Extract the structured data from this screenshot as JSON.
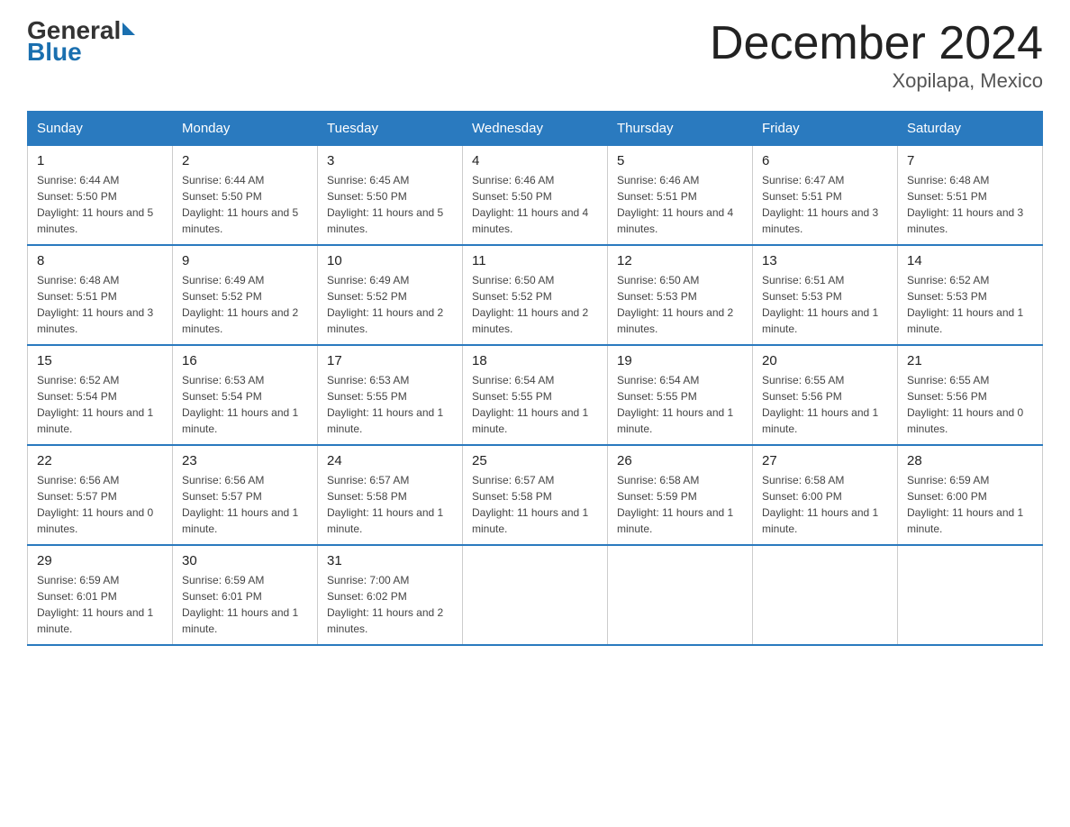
{
  "logo": {
    "line1": "General",
    "line2": "Blue",
    "triangle": true
  },
  "title": "December 2024",
  "subtitle": "Xopilapa, Mexico",
  "days_of_week": [
    "Sunday",
    "Monday",
    "Tuesday",
    "Wednesday",
    "Thursday",
    "Friday",
    "Saturday"
  ],
  "weeks": [
    [
      {
        "day": "1",
        "sunrise": "6:44 AM",
        "sunset": "5:50 PM",
        "daylight": "11 hours and 5 minutes."
      },
      {
        "day": "2",
        "sunrise": "6:44 AM",
        "sunset": "5:50 PM",
        "daylight": "11 hours and 5 minutes."
      },
      {
        "day": "3",
        "sunrise": "6:45 AM",
        "sunset": "5:50 PM",
        "daylight": "11 hours and 5 minutes."
      },
      {
        "day": "4",
        "sunrise": "6:46 AM",
        "sunset": "5:50 PM",
        "daylight": "11 hours and 4 minutes."
      },
      {
        "day": "5",
        "sunrise": "6:46 AM",
        "sunset": "5:51 PM",
        "daylight": "11 hours and 4 minutes."
      },
      {
        "day": "6",
        "sunrise": "6:47 AM",
        "sunset": "5:51 PM",
        "daylight": "11 hours and 3 minutes."
      },
      {
        "day": "7",
        "sunrise": "6:48 AM",
        "sunset": "5:51 PM",
        "daylight": "11 hours and 3 minutes."
      }
    ],
    [
      {
        "day": "8",
        "sunrise": "6:48 AM",
        "sunset": "5:51 PM",
        "daylight": "11 hours and 3 minutes."
      },
      {
        "day": "9",
        "sunrise": "6:49 AM",
        "sunset": "5:52 PM",
        "daylight": "11 hours and 2 minutes."
      },
      {
        "day": "10",
        "sunrise": "6:49 AM",
        "sunset": "5:52 PM",
        "daylight": "11 hours and 2 minutes."
      },
      {
        "day": "11",
        "sunrise": "6:50 AM",
        "sunset": "5:52 PM",
        "daylight": "11 hours and 2 minutes."
      },
      {
        "day": "12",
        "sunrise": "6:50 AM",
        "sunset": "5:53 PM",
        "daylight": "11 hours and 2 minutes."
      },
      {
        "day": "13",
        "sunrise": "6:51 AM",
        "sunset": "5:53 PM",
        "daylight": "11 hours and 1 minute."
      },
      {
        "day": "14",
        "sunrise": "6:52 AM",
        "sunset": "5:53 PM",
        "daylight": "11 hours and 1 minute."
      }
    ],
    [
      {
        "day": "15",
        "sunrise": "6:52 AM",
        "sunset": "5:54 PM",
        "daylight": "11 hours and 1 minute."
      },
      {
        "day": "16",
        "sunrise": "6:53 AM",
        "sunset": "5:54 PM",
        "daylight": "11 hours and 1 minute."
      },
      {
        "day": "17",
        "sunrise": "6:53 AM",
        "sunset": "5:55 PM",
        "daylight": "11 hours and 1 minute."
      },
      {
        "day": "18",
        "sunrise": "6:54 AM",
        "sunset": "5:55 PM",
        "daylight": "11 hours and 1 minute."
      },
      {
        "day": "19",
        "sunrise": "6:54 AM",
        "sunset": "5:55 PM",
        "daylight": "11 hours and 1 minute."
      },
      {
        "day": "20",
        "sunrise": "6:55 AM",
        "sunset": "5:56 PM",
        "daylight": "11 hours and 1 minute."
      },
      {
        "day": "21",
        "sunrise": "6:55 AM",
        "sunset": "5:56 PM",
        "daylight": "11 hours and 0 minutes."
      }
    ],
    [
      {
        "day": "22",
        "sunrise": "6:56 AM",
        "sunset": "5:57 PM",
        "daylight": "11 hours and 0 minutes."
      },
      {
        "day": "23",
        "sunrise": "6:56 AM",
        "sunset": "5:57 PM",
        "daylight": "11 hours and 1 minute."
      },
      {
        "day": "24",
        "sunrise": "6:57 AM",
        "sunset": "5:58 PM",
        "daylight": "11 hours and 1 minute."
      },
      {
        "day": "25",
        "sunrise": "6:57 AM",
        "sunset": "5:58 PM",
        "daylight": "11 hours and 1 minute."
      },
      {
        "day": "26",
        "sunrise": "6:58 AM",
        "sunset": "5:59 PM",
        "daylight": "11 hours and 1 minute."
      },
      {
        "day": "27",
        "sunrise": "6:58 AM",
        "sunset": "6:00 PM",
        "daylight": "11 hours and 1 minute."
      },
      {
        "day": "28",
        "sunrise": "6:59 AM",
        "sunset": "6:00 PM",
        "daylight": "11 hours and 1 minute."
      }
    ],
    [
      {
        "day": "29",
        "sunrise": "6:59 AM",
        "sunset": "6:01 PM",
        "daylight": "11 hours and 1 minute."
      },
      {
        "day": "30",
        "sunrise": "6:59 AM",
        "sunset": "6:01 PM",
        "daylight": "11 hours and 1 minute."
      },
      {
        "day": "31",
        "sunrise": "7:00 AM",
        "sunset": "6:02 PM",
        "daylight": "11 hours and 2 minutes."
      },
      null,
      null,
      null,
      null
    ]
  ]
}
